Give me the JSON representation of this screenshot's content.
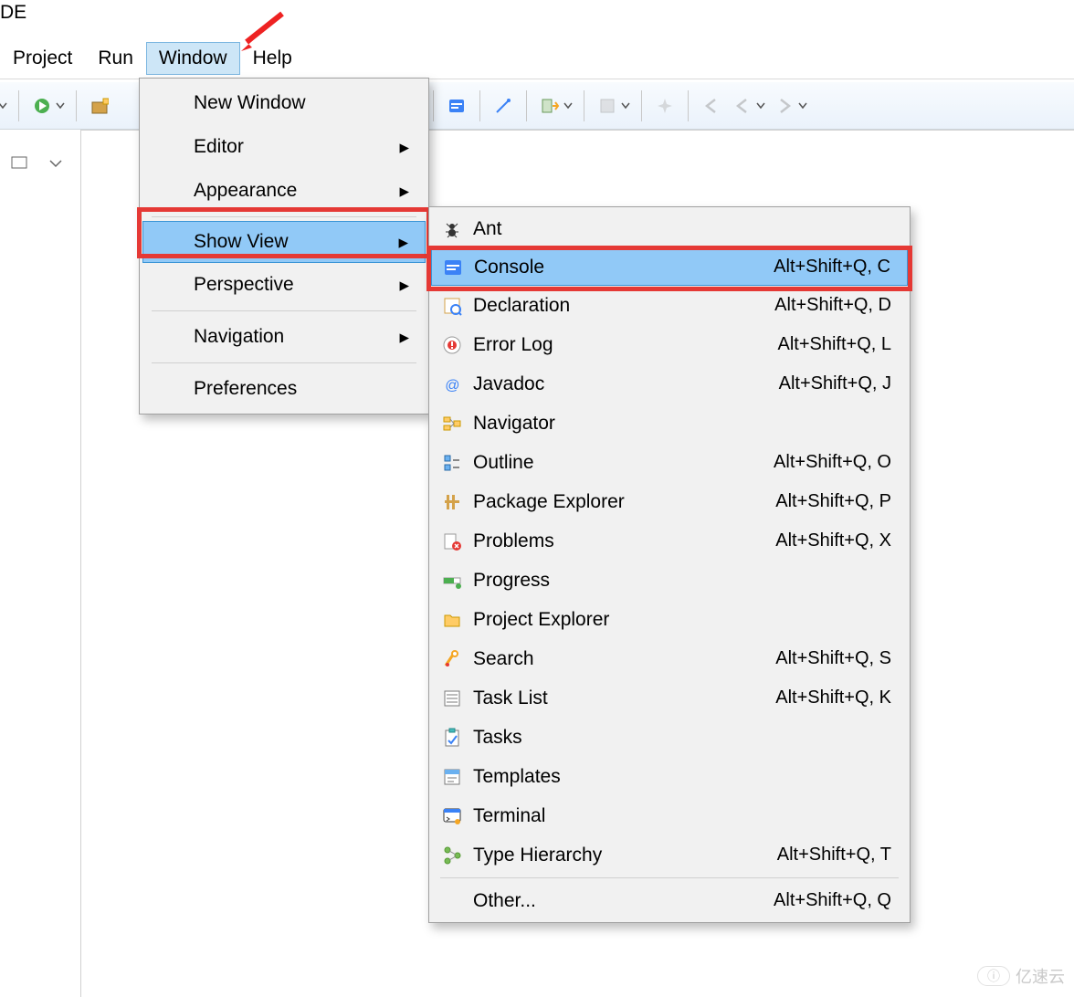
{
  "title_fragment": "DE",
  "menubar": {
    "project": "Project",
    "run": "Run",
    "window": "Window",
    "help": "Help"
  },
  "window_menu": {
    "new_window": "New Window",
    "editor": "Editor",
    "appearance": "Appearance",
    "show_view": "Show View",
    "perspective": "Perspective",
    "navigation": "Navigation",
    "preferences": "Preferences"
  },
  "show_view_menu": {
    "items": [
      {
        "label": "Ant",
        "shortcut": "",
        "icon": "ant"
      },
      {
        "label": "Console",
        "shortcut": "Alt+Shift+Q, C",
        "icon": "console",
        "highlight": true
      },
      {
        "label": "Declaration",
        "shortcut": "Alt+Shift+Q, D",
        "icon": "declaration"
      },
      {
        "label": "Error Log",
        "shortcut": "Alt+Shift+Q, L",
        "icon": "errorlog"
      },
      {
        "label": "Javadoc",
        "shortcut": "Alt+Shift+Q, J",
        "icon": "javadoc"
      },
      {
        "label": "Navigator",
        "shortcut": "",
        "icon": "navigator"
      },
      {
        "label": "Outline",
        "shortcut": "Alt+Shift+Q, O",
        "icon": "outline"
      },
      {
        "label": "Package Explorer",
        "shortcut": "Alt+Shift+Q, P",
        "icon": "package"
      },
      {
        "label": "Problems",
        "shortcut": "Alt+Shift+Q, X",
        "icon": "problems"
      },
      {
        "label": "Progress",
        "shortcut": "",
        "icon": "progress"
      },
      {
        "label": "Project Explorer",
        "shortcut": "",
        "icon": "project"
      },
      {
        "label": "Search",
        "shortcut": "Alt+Shift+Q, S",
        "icon": "search"
      },
      {
        "label": "Task List",
        "shortcut": "Alt+Shift+Q, K",
        "icon": "tasklist"
      },
      {
        "label": "Tasks",
        "shortcut": "",
        "icon": "tasks"
      },
      {
        "label": "Templates",
        "shortcut": "",
        "icon": "templates"
      },
      {
        "label": "Terminal",
        "shortcut": "",
        "icon": "terminal"
      },
      {
        "label": "Type Hierarchy",
        "shortcut": "Alt+Shift+Q, T",
        "icon": "typehier"
      }
    ],
    "other": {
      "label": "Other...",
      "shortcut": "Alt+Shift+Q, Q"
    }
  },
  "annotation": {
    "arrow_target": "Window menu"
  },
  "watermark": "亿速云"
}
